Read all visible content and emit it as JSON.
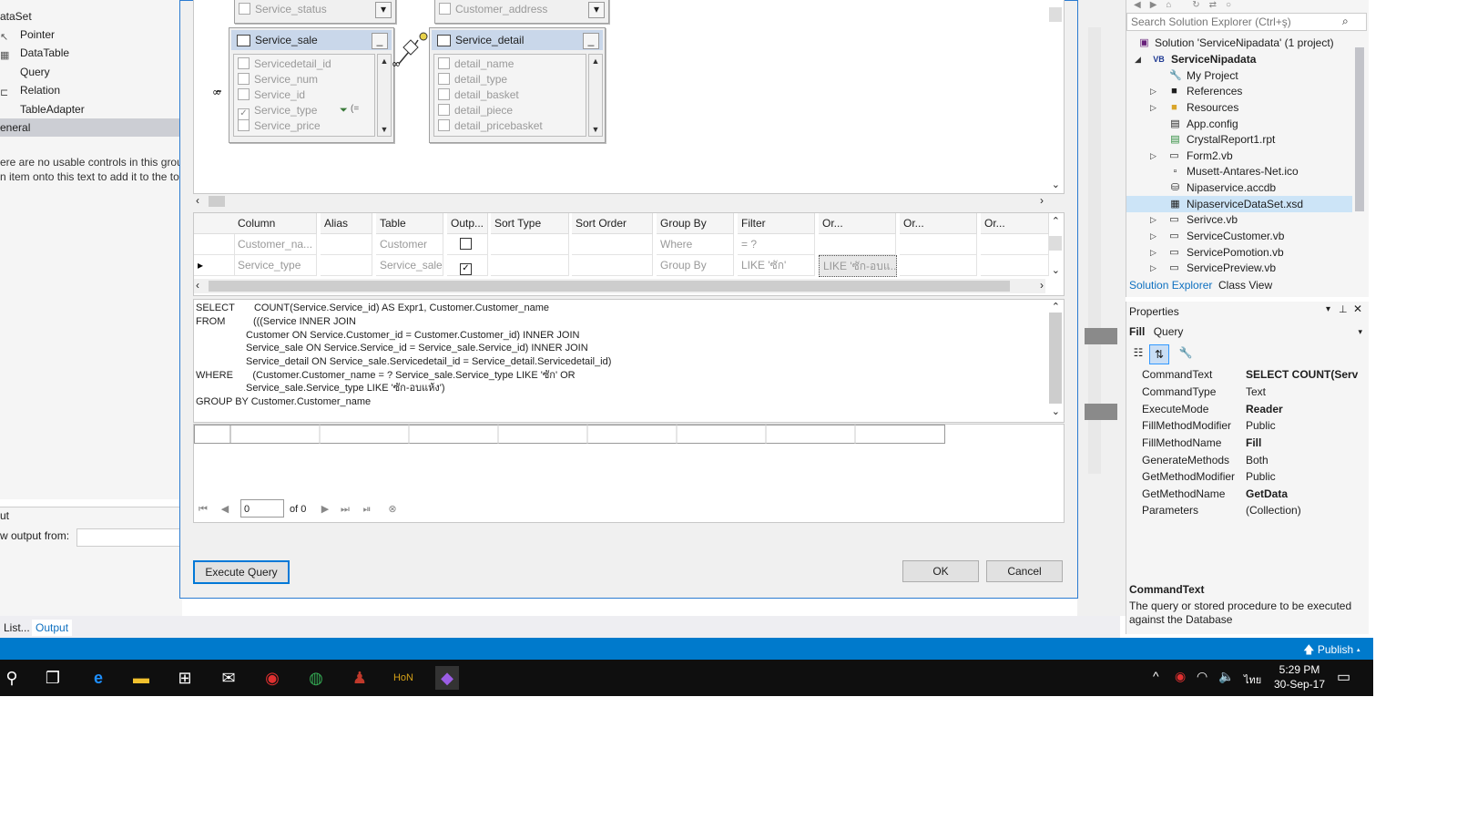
{
  "toolbox": {
    "header": "ataSet",
    "items": [
      "Pointer",
      "DataTable",
      "Query",
      "Relation",
      "TableAdapter"
    ],
    "section": "eneral",
    "message_line1": "ere are no usable controls in this group",
    "message_line2": "n item onto this text to add it to the too"
  },
  "output_panel": {
    "title": "ut",
    "show_from_label": "w output from:"
  },
  "bottom_tabs": [
    "List...",
    "Output"
  ],
  "diagram": {
    "top_left_fields": [
      "Service_status",
      "Customer_address"
    ],
    "service_sale": {
      "title": "Service_sale",
      "columns": [
        "Servicedetail_id",
        "Service_num",
        "Service_id",
        "Service_type",
        "Service_price"
      ],
      "filter_mark": "(="
    },
    "service_detail": {
      "title": "Service_detail",
      "columns": [
        "detail_name",
        "detail_type",
        "detail_basket",
        "detail_piece",
        "detail_pricebasket"
      ]
    }
  },
  "grid": {
    "headers": [
      "Column",
      "Alias",
      "Table",
      "Outp...",
      "Sort Type",
      "Sort Order",
      "Group By",
      "Filter",
      "Or...",
      "Or...",
      "Or..."
    ],
    "rows": [
      {
        "column": "Customer_na...",
        "alias": "",
        "table": "Customer",
        "group_by": "Where",
        "filter": "= ?",
        "or1": ""
      },
      {
        "column": "Service_type",
        "alias": "",
        "table": "Service_sale",
        "group_by": "Group By",
        "filter": "LIKE 'ซัก'",
        "or1": "LIKE 'ซัก-อบแ..."
      }
    ]
  },
  "sql": [
    "SELECT       COUNT(Service.Service_id) AS Expr1, Customer.Customer_name",
    "FROM          (((Service INNER JOIN",
    "                  Customer ON Service.Customer_id = Customer.Customer_id) INNER JOIN",
    "                  Service_sale ON Service.Service_id = Service_sale.Service_id) INNER JOIN",
    "                  Service_detail ON Service_sale.Servicedetail_id = Service_detail.Servicedetail_id)",
    "WHERE       (Customer.Customer_name = ? Service_sale.Service_type LIKE 'ซัก' OR",
    "                  Service_sale.Service_type LIKE 'ซัก-อบแห้ง')",
    "GROUP BY Customer.Customer_name"
  ],
  "navigator": {
    "position": "0",
    "of_label": "of 0"
  },
  "buttons": {
    "execute": "Execute Query",
    "ok": "OK",
    "cancel": "Cancel"
  },
  "solution_explorer": {
    "search_placeholder": "Search Solution Explorer (Ctrl+ş)",
    "solution": "Solution 'ServiceNipadata' (1 project)",
    "project": "ServiceNipadata",
    "items": [
      "My Project",
      "References",
      "Resources",
      "App.config",
      "CrystalReport1.rpt",
      "Form2.vb",
      "Musett-Antares-Net.ico",
      "Nipaservice.accdb",
      "NipaserviceDataSet.xsd",
      "Serivce.vb",
      "ServiceCustomer.vb",
      "ServicePomotion.vb",
      "ServicePreview.vb"
    ],
    "tabs": [
      "Solution Explorer",
      "Class View"
    ]
  },
  "properties": {
    "title": "Properties",
    "object": "Fill",
    "object_type": "Query",
    "rows": [
      {
        "name": "CommandText",
        "value": "SELECT      COUNT(Serv"
      },
      {
        "name": "CommandType",
        "value": "Text"
      },
      {
        "name": "ExecuteMode",
        "value": "Reader"
      },
      {
        "name": "FillMethodModifier",
        "value": "Public"
      },
      {
        "name": "FillMethodName",
        "value": "Fill"
      },
      {
        "name": "GenerateMethods",
        "value": "Both"
      },
      {
        "name": "GetMethodModifier",
        "value": "Public"
      },
      {
        "name": "GetMethodName",
        "value": "GetData"
      },
      {
        "name": "Parameters",
        "value": "(Collection)"
      }
    ],
    "desc_title": "CommandText",
    "desc_text1": "The query or stored procedure to be executed",
    "desc_text2": "against the Database"
  },
  "status": {
    "publish": "Publish"
  },
  "taskbar": {
    "time": "5:29 PM",
    "date": "30-Sep-17",
    "lang": "ไทย"
  },
  "colors": {
    "accent": "#007acc",
    "selection": "#cce4f7",
    "dialog_border": "#2b7bd1"
  }
}
